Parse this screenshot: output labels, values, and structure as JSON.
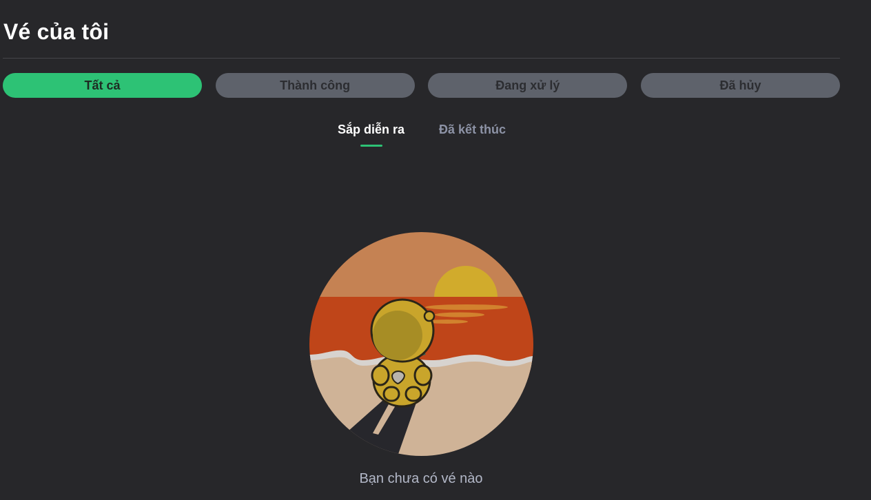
{
  "page": {
    "title": "Vé của tôi"
  },
  "filter_tabs": [
    {
      "label": "Tất cả",
      "active": true
    },
    {
      "label": "Thành công",
      "active": false
    },
    {
      "label": "Đang xử lý",
      "active": false
    },
    {
      "label": "Đã hủy",
      "active": false
    }
  ],
  "sub_tabs": [
    {
      "label": "Sắp diễn ra",
      "active": true
    },
    {
      "label": "Đã kết thúc",
      "active": false
    }
  ],
  "empty_state": {
    "message": "Bạn chưa có vé nào",
    "illustration": "sunset-beach-character-illustration"
  },
  "colors": {
    "background": "#27272a",
    "accent": "#2dc275",
    "tab_inactive": "#5e626b"
  }
}
